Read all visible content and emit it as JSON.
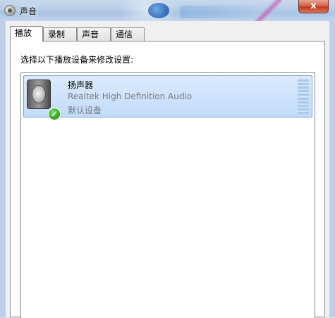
{
  "window": {
    "title": "声音",
    "close_label": "x",
    "icon": "speaker-system-icon"
  },
  "tabs": [
    {
      "label": "播放",
      "active": true
    },
    {
      "label": "录制",
      "active": false
    },
    {
      "label": "声音",
      "active": false
    },
    {
      "label": "通信",
      "active": false
    }
  ],
  "playback": {
    "instruction": "选择以下播放设备来修改设置:",
    "devices": [
      {
        "name": "扬声器",
        "driver": "Realtek High Definition Audio",
        "status": "默认设备",
        "icon": "speaker-icon",
        "badge": "default-check-icon",
        "selected": true
      }
    ]
  },
  "colors": {
    "selection": "#c1dbfc",
    "selection_border": "#7da2ce",
    "close_button": "#c0391d",
    "status_text": "#7a7a7a"
  }
}
